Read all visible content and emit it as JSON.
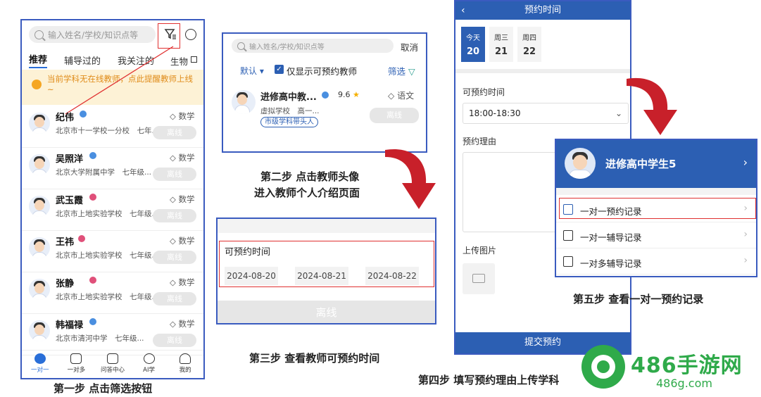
{
  "panel1": {
    "search_placeholder": "输入姓名/学校/知识点等",
    "tabs": [
      "推荐",
      "辅导过的",
      "我关注的"
    ],
    "subject_tab": "生物",
    "notice": "当前学科无在线教师，点此提醒教师上线~",
    "teachers": [
      {
        "name": "纪伟",
        "school": "北京市十一学校一分校　七年...",
        "subject": "数学",
        "status": "离线",
        "badge_color": "#4a8fe0"
      },
      {
        "name": "吴照洋",
        "school": "北京大学附属中学　七年级...",
        "subject": "数学",
        "status": "离线",
        "badge_color": "#4a8fe0"
      },
      {
        "name": "武玉霞",
        "school": "北京市上地实验学校　七年级...",
        "subject": "数学",
        "status": "离线",
        "badge_color": "#e0507a"
      },
      {
        "name": "王祎",
        "school": "北京市上地实验学校　七年级...",
        "subject": "数学",
        "status": "离线",
        "badge_color": "#e0507a"
      },
      {
        "name": "张静",
        "school": "北京市上地实验学校　七年级...",
        "subject": "数学",
        "status": "离线",
        "badge_color": "#e0507a"
      },
      {
        "name": "韩福禄",
        "school": "北京市清河中学　七年级...",
        "subject": "数学",
        "status": "离线",
        "badge_color": "#4a8fe0"
      }
    ],
    "nav": [
      "一对一",
      "一对多",
      "问答中心",
      "AI学",
      "我的"
    ],
    "caption": "第一步 点击筛选按钮"
  },
  "panel2": {
    "search_placeholder": "输入姓名/学校/知识点等",
    "cancel": "取消",
    "sort": "默认",
    "checkbox_label": "仅显示可预约教师",
    "filter": "筛选",
    "teacher_name": "进修高中教...",
    "rating": "9.6",
    "subject": "语文",
    "school": "虚拟学校　高一...",
    "tag": "市级学科带头人",
    "status": "离线",
    "caption_line1": "第二步 点击教师头像",
    "caption_line2": "进入教师个人介绍页面"
  },
  "panel3": {
    "title": "可预约时间",
    "dates": [
      "2024-08-20",
      "2024-08-21",
      "2024-08-22"
    ],
    "status": "离线",
    "caption": "第三步 查看教师可预约时间"
  },
  "panel4": {
    "title": "预约时间",
    "days": [
      {
        "week": "今天",
        "day": "20"
      },
      {
        "week": "周三",
        "day": "21"
      },
      {
        "week": "周四",
        "day": "22"
      }
    ],
    "time_label": "可预约时间",
    "time_value": "18:00-18:30",
    "reason_label": "预约理由",
    "upload_label": "上传图片",
    "submit": "提交预约",
    "caption": "第四步 填写预约理由上传学科"
  },
  "panel5": {
    "user_name": "进修高中学生5",
    "items": [
      "一对一预约记录",
      "一对一辅导记录",
      "一对多辅导记录"
    ],
    "caption": "第五步 查看一对一预约记录"
  },
  "watermark": {
    "name": "486手游网",
    "url": "486g.com"
  }
}
